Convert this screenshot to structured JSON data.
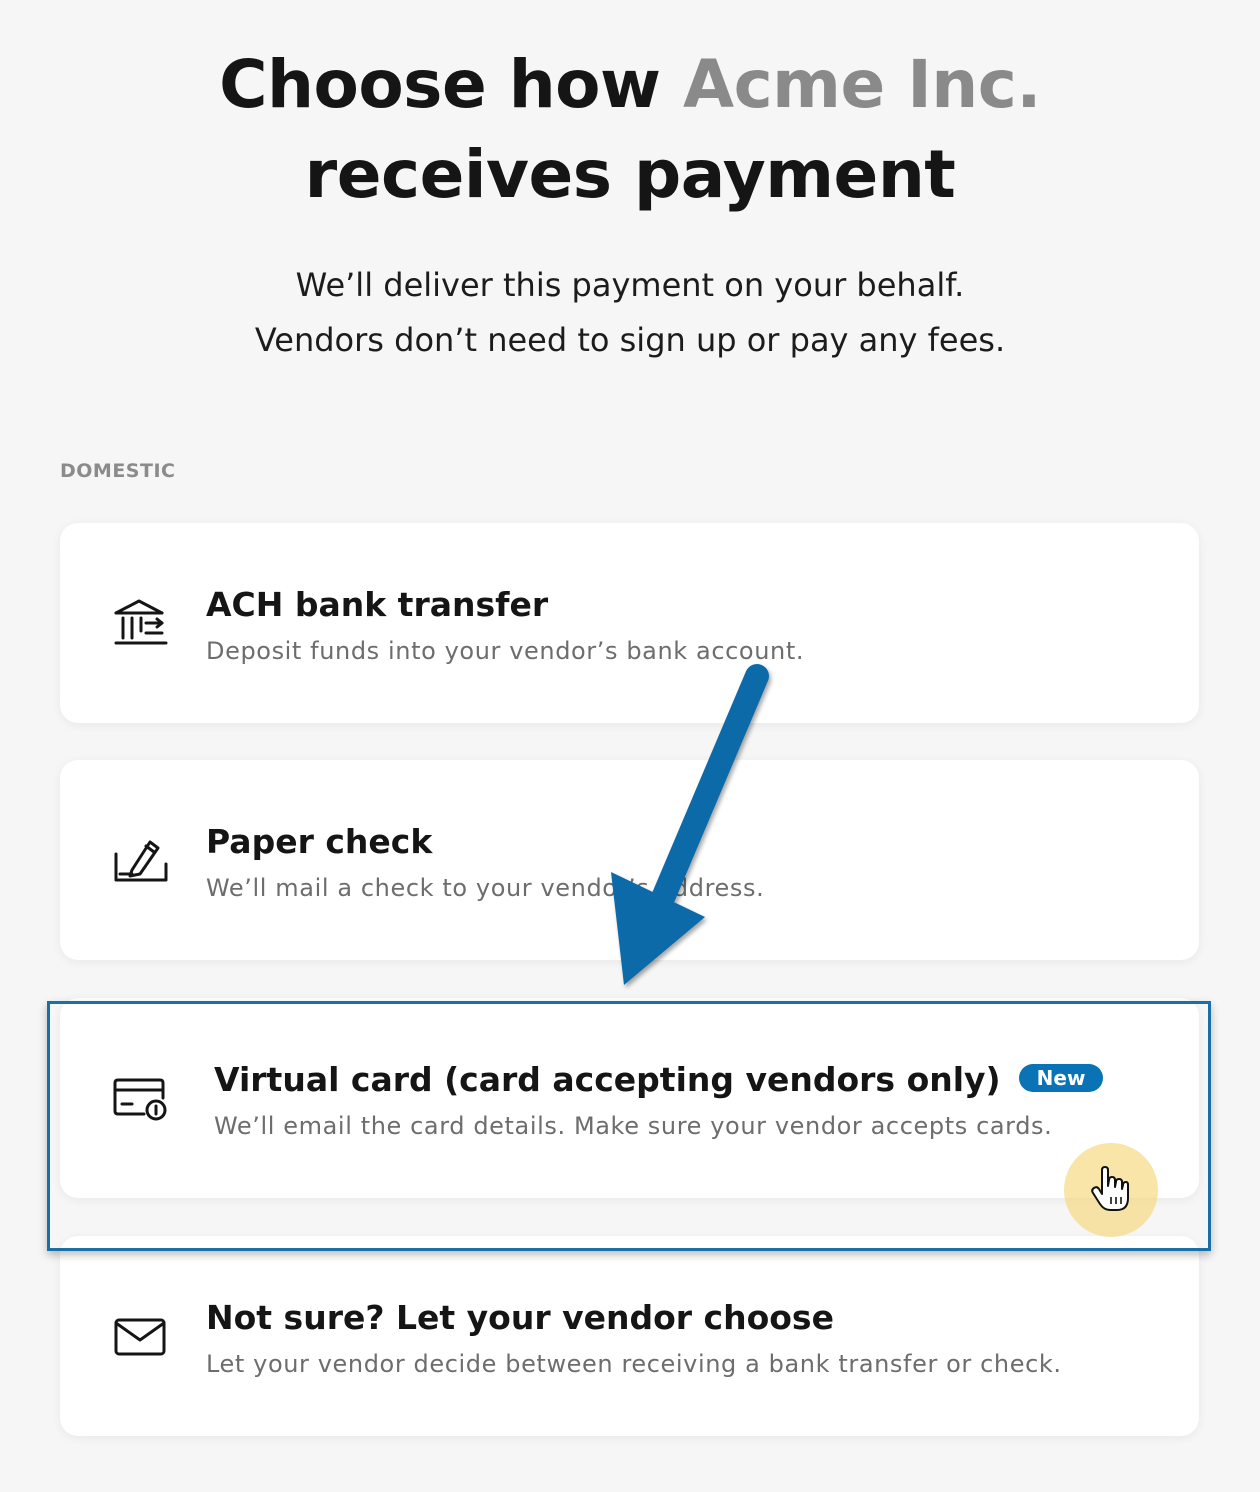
{
  "header": {
    "title_before": "Choose how ",
    "vendor_name": "Acme Inc.",
    "title_after": " receives payment",
    "subtitle_line1": "We’ll deliver this payment on your behalf.",
    "subtitle_line2": "Vendors don’t need to sign up or pay any fees."
  },
  "section": {
    "label": "DOMESTIC"
  },
  "options": [
    {
      "title": "ACH bank transfer",
      "description": "Deposit funds into your vendor’s bank account.",
      "icon": "bank-icon"
    },
    {
      "title": "Paper check",
      "description": "We’ll mail a check to your vendor’s address.",
      "icon": "check-icon"
    },
    {
      "title": "Virtual card (card accepting vendors only)",
      "badge": "New",
      "description": "We’ll email the card details. Make sure your vendor accepts cards.",
      "icon": "virtual-card-icon"
    },
    {
      "title": "Not sure? Let your vendor choose",
      "description": "Let your vendor decide between receiving a bank transfer or check.",
      "icon": "envelope-icon"
    }
  ],
  "colors": {
    "accent": "#0a73b6",
    "highlight_border": "#1a6fa6",
    "vendor_name": "#8a8a8a",
    "cursor_halo": "#f5d778"
  }
}
